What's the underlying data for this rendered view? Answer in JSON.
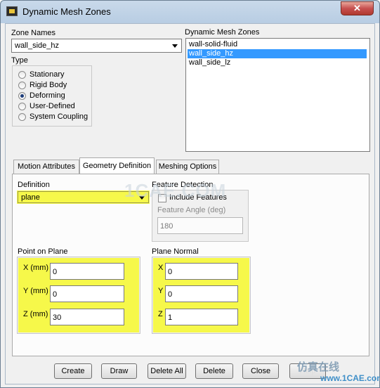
{
  "window": {
    "title": "Dynamic Mesh Zones",
    "close_glyph": "✕"
  },
  "zone_names": {
    "label": "Zone Names",
    "selected": "wall_side_hz"
  },
  "type": {
    "label": "Type",
    "options": [
      {
        "label": "Stationary",
        "checked": false
      },
      {
        "label": "Rigid Body",
        "checked": false
      },
      {
        "label": "Deforming",
        "checked": true
      },
      {
        "label": "User-Defined",
        "checked": false
      },
      {
        "label": "System Coupling",
        "checked": false
      }
    ]
  },
  "dynamic_mesh_zones": {
    "label": "Dynamic Mesh Zones",
    "items": [
      {
        "label": "wall-solid-fluid",
        "selected": false
      },
      {
        "label": "wall_side_hz",
        "selected": true
      },
      {
        "label": "wall_side_lz",
        "selected": false
      }
    ]
  },
  "tabs": [
    {
      "label": "Motion Attributes",
      "active": false
    },
    {
      "label": "Geometry Definition",
      "active": true
    },
    {
      "label": "Meshing Options",
      "active": false
    }
  ],
  "definition": {
    "label": "Definition",
    "selected": "plane"
  },
  "feature_detection": {
    "label": "Feature Detection",
    "include_label": "Include Features",
    "include_checked": false,
    "angle_label": "Feature Angle (deg)",
    "angle_value": "180"
  },
  "point_on_plane": {
    "label": "Point on Plane",
    "x_label": "X (mm)",
    "x_value": "0",
    "y_label": "Y (mm)",
    "y_value": "0",
    "z_label": "Z (mm)",
    "z_value": "30"
  },
  "plane_normal": {
    "label": "Plane Normal",
    "x_label": "X",
    "x_value": "0",
    "y_label": "Y",
    "y_value": "0",
    "z_label": "Z",
    "z_value": "1"
  },
  "buttons": {
    "create": "Create",
    "draw": "Draw",
    "delete_all": "Delete All",
    "delete": "Delete",
    "close": "Close",
    "help": "Help"
  },
  "watermarks": {
    "center": "1CAE.COM",
    "logo": "仿真在线",
    "url": "www.1CAE.com"
  },
  "colors": {
    "highlight": "#f6f84a",
    "selection": "#3399ff"
  }
}
